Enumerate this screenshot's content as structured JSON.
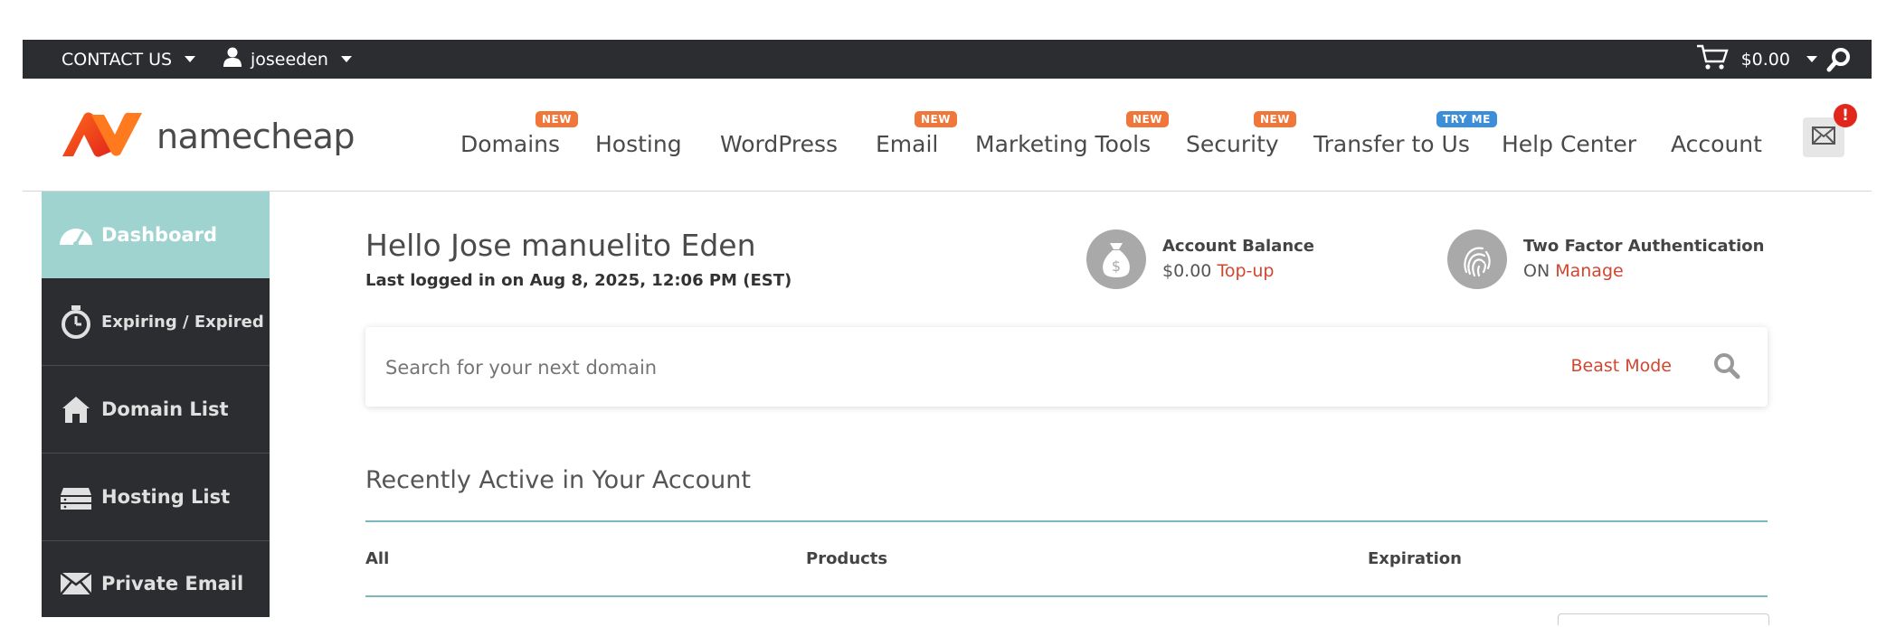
{
  "topbar": {
    "contact_label": "CONTACT US",
    "user_label": "joseeden",
    "cart_amount": "$0.00"
  },
  "logo": {
    "text": "namecheap"
  },
  "nav": {
    "items": [
      {
        "label": "Domains",
        "badge": "NEW"
      },
      {
        "label": "Hosting"
      },
      {
        "label": "WordPress"
      },
      {
        "label": "Email",
        "badge": "NEW"
      },
      {
        "label": "Marketing Tools",
        "badge": "NEW"
      },
      {
        "label": "Security",
        "badge": "NEW"
      },
      {
        "label": "Transfer to Us",
        "badge": "TRY ME"
      },
      {
        "label": "Help Center"
      },
      {
        "label": "Account"
      }
    ],
    "notification_count": "!"
  },
  "sidebar": {
    "items": [
      {
        "label": "Dashboard"
      },
      {
        "label": "Expiring / Expired"
      },
      {
        "label": "Domain List"
      },
      {
        "label": "Hosting List"
      },
      {
        "label": "Private Email"
      }
    ]
  },
  "main": {
    "greeting": "Hello Jose manuelito Eden",
    "last_logged": "Last logged in on Aug 8, 2025, 12:06 PM (EST)",
    "balance": {
      "title": "Account Balance",
      "amount": "$0.00",
      "action": "Top-up"
    },
    "two_factor": {
      "title": "Two Factor Authentication",
      "status": "ON",
      "action": "Manage"
    },
    "search": {
      "placeholder": "Search for your next domain",
      "beast_mode": "Beast Mode"
    },
    "recent": {
      "title": "Recently Active in Your Account",
      "columns": [
        "All",
        "Products",
        "Expiration"
      ]
    }
  },
  "colors": {
    "topbar_bg": "#2b2d30",
    "accent_red": "#d1462f",
    "sidebar_active": "#9fd3d0",
    "badge_orange": "#f0763a",
    "badge_blue": "#3d8ed8",
    "rule_teal": "#79b9bc"
  }
}
